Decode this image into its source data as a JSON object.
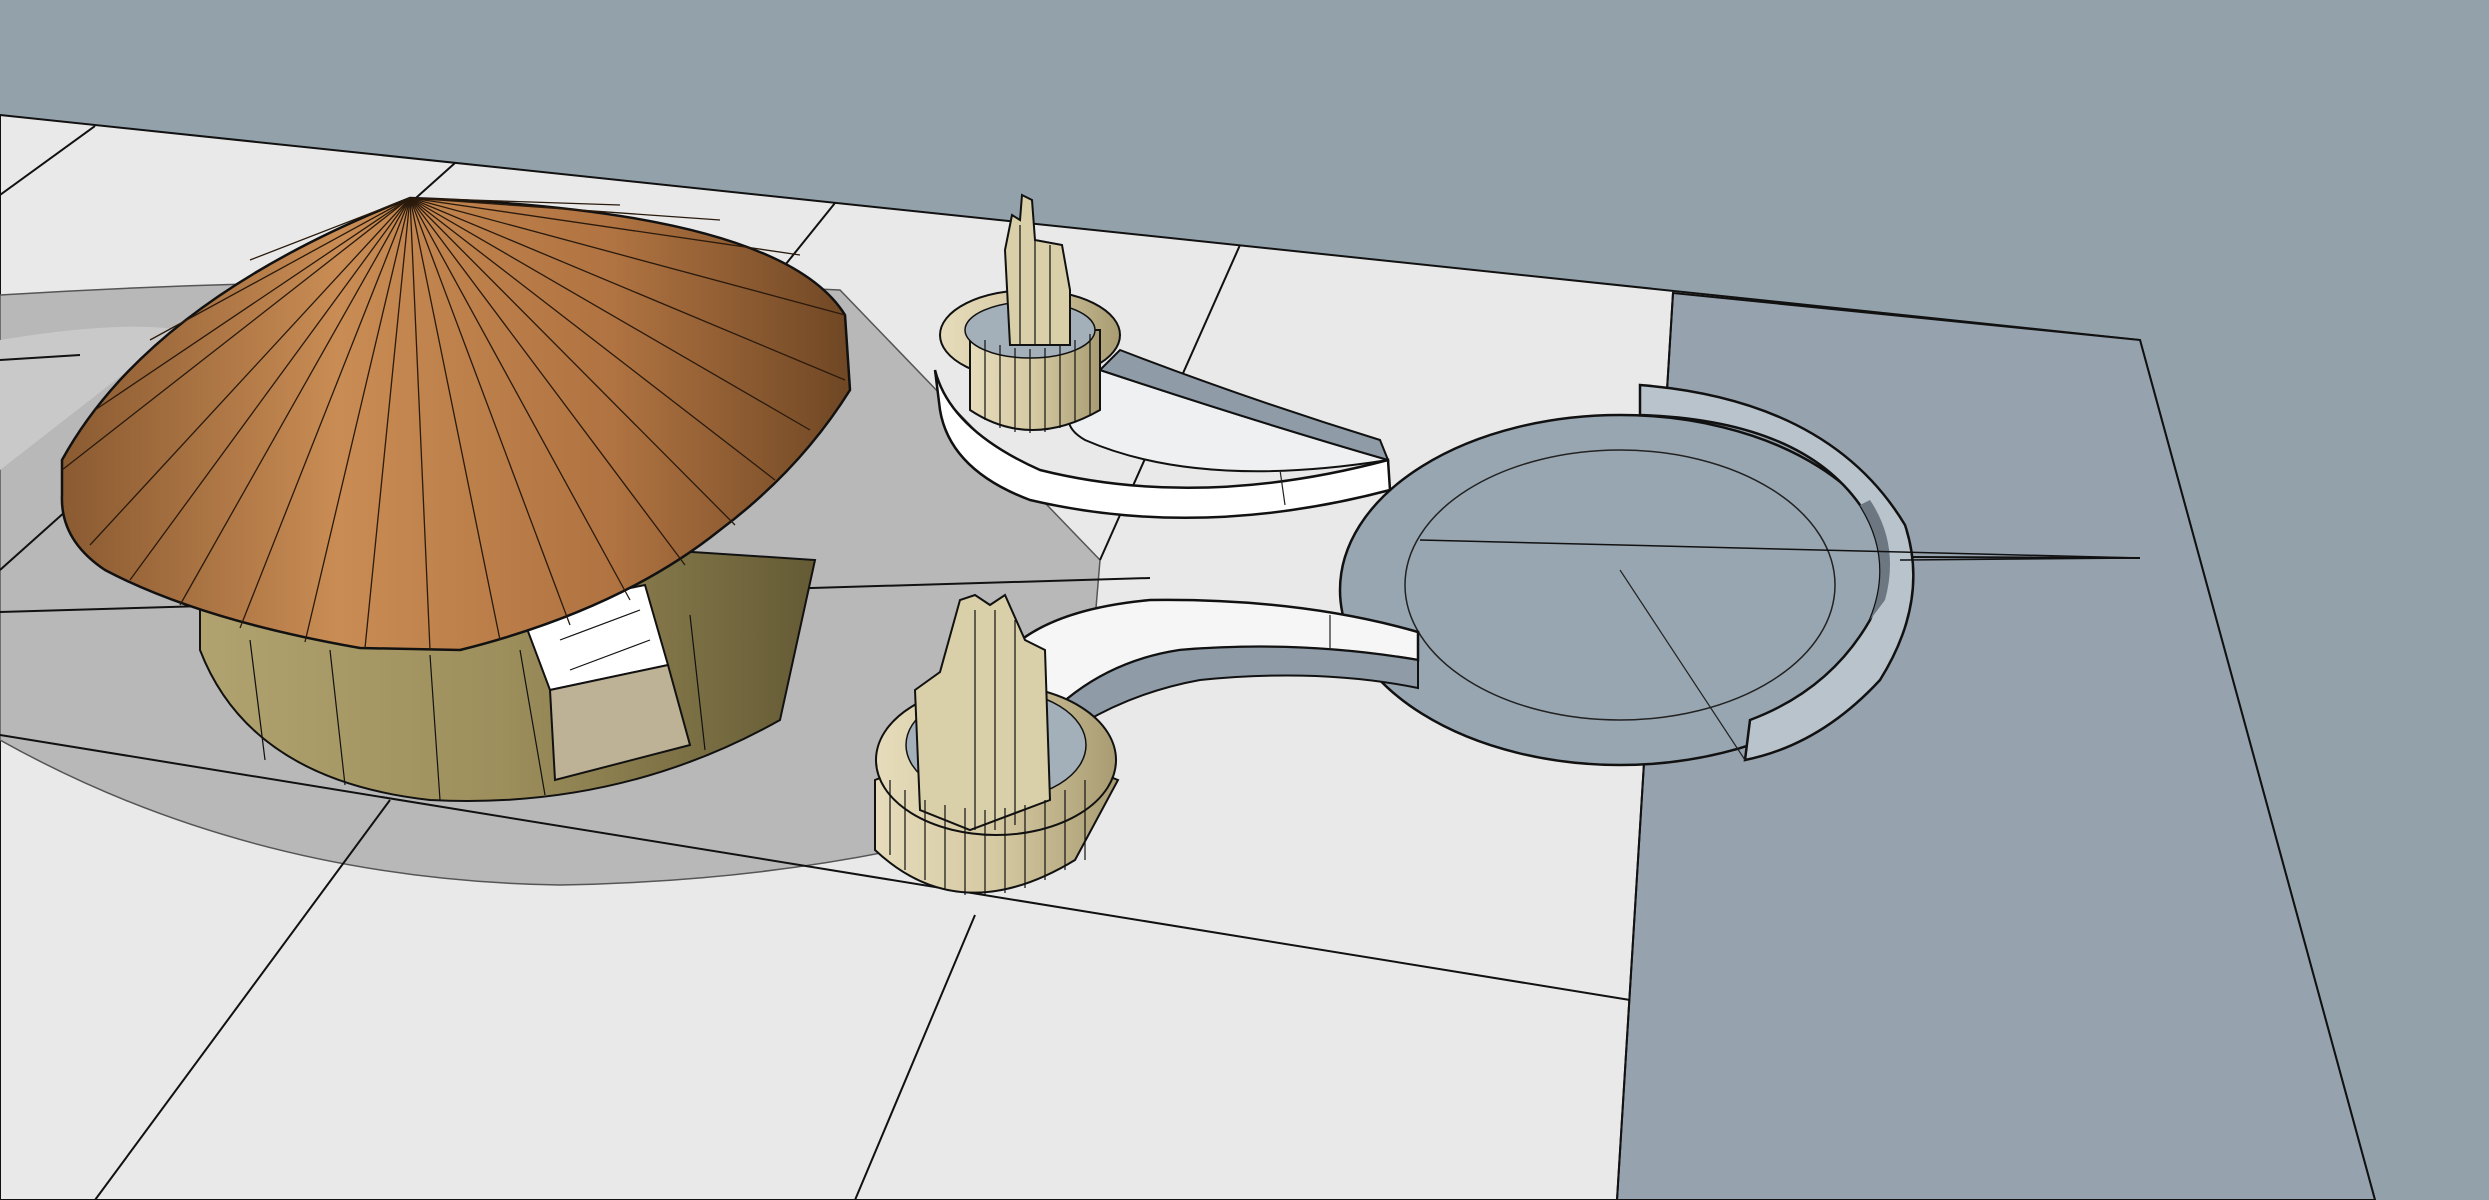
{
  "app": {
    "kind": "3d-modeling-viewport"
  },
  "colors": {
    "sky": "#93a1ab",
    "ground_light": "#e9e9e9",
    "ground_shadow": "#b8b8b8",
    "water": "#96a3ae",
    "roof_light": "#c78a52",
    "roof_dark": "#7f5430",
    "wall_olive": "#9d8f5c",
    "tower_beige": "#d8cda8",
    "edge": "#111111"
  },
  "model": {
    "objects": [
      {
        "name": "round-hut",
        "parts": [
          "conical-roof",
          "cylindrical-wall",
          "window"
        ]
      },
      {
        "name": "tower-upper",
        "parts": [
          "ribbed-cylinder",
          "crenellated-rim",
          "spout"
        ]
      },
      {
        "name": "tower-lower",
        "parts": [
          "ribbed-cylinder",
          "crenellated-rim",
          "spout"
        ]
      },
      {
        "name": "curved-channel-upper"
      },
      {
        "name": "curved-channel-lower"
      },
      {
        "name": "circular-basin"
      }
    ]
  }
}
